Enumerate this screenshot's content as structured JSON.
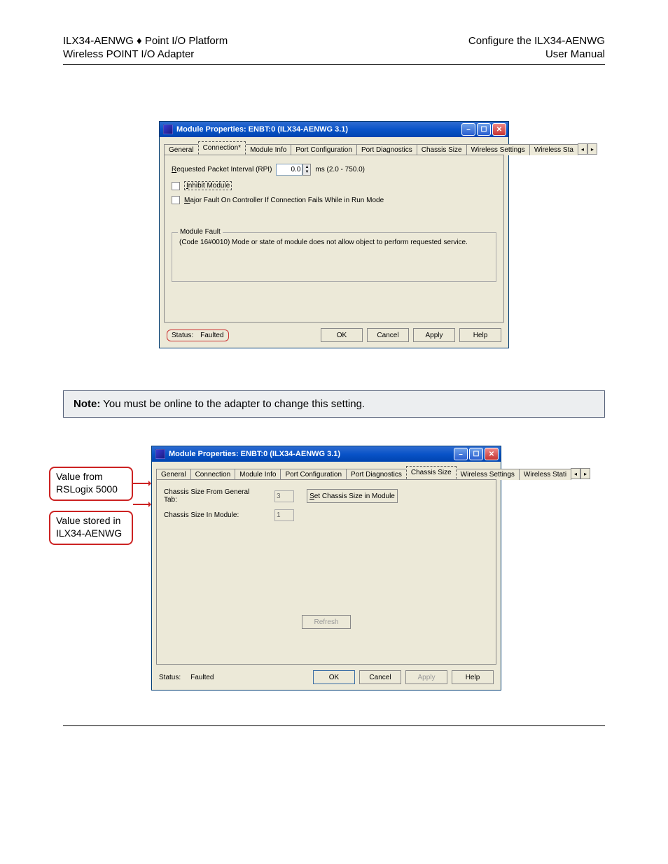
{
  "header": {
    "left1": "ILX34-AENWG ♦ Point I/O Platform",
    "left2": "Wireless POINT I/O Adapter",
    "right1": "Configure the ILX34-AENWG",
    "right2": "User Manual"
  },
  "win1": {
    "title": "Module Properties: ENBT:0 (ILX34-AENWG 3.1)",
    "tabs": [
      "General",
      "Connection*",
      "Module Info",
      "Port Configuration",
      "Port Diagnostics",
      "Chassis Size",
      "Wireless Settings",
      "Wireless Sta"
    ],
    "active_tab": 1,
    "rpi_label_pre": "R",
    "rpi_label_rest": "equested Packet Interval (RPI)",
    "rpi_value": "0.0",
    "rpi_units": "ms (2.0 - 750.0)",
    "inhibit_label": "Inhibit Module",
    "inhibit_u": "I",
    "inhibit_rest": "nhibit Module",
    "major_fault_pre": "M",
    "major_fault_rest": "ajor Fault On Controller If Connection Fails While in Run Mode",
    "module_fault_legend": "Module Fault",
    "module_fault_msg": "(Code 16#0010) Mode or state of module does not allow object to perform requested service.",
    "status_label": "Status:",
    "status_value": "Faulted",
    "ok": "OK",
    "cancel": "Cancel",
    "apply": "Apply",
    "help": "Help"
  },
  "note": {
    "prefix": "Note:",
    "text": " You must be online to the adapter to change this setting."
  },
  "callouts": {
    "c1a": "Value from",
    "c1b": "RSLogix 5000",
    "c2a": "Value stored in",
    "c2b": "ILX34-AENWG"
  },
  "win2": {
    "title": "Module Properties: ENBT:0 (ILX34-AENWG 3.1)",
    "tabs": [
      "General",
      "Connection",
      "Module Info",
      "Port Configuration",
      "Port Diagnostics",
      "Chassis Size",
      "Wireless Settings",
      "Wireless Stati"
    ],
    "active_tab": 5,
    "row1_label": "Chassis Size From General Tab:",
    "row1_value": "3",
    "row2_label": "Chassis Size In Module:",
    "row2_value": "1",
    "set_btn_pre": "S",
    "set_btn_rest": "et Chassis Size in Module",
    "refresh": "Refresh",
    "status_label": "Status:",
    "status_value": "Faulted",
    "ok": "OK",
    "cancel": "Cancel",
    "apply": "Apply",
    "help": "Help"
  }
}
